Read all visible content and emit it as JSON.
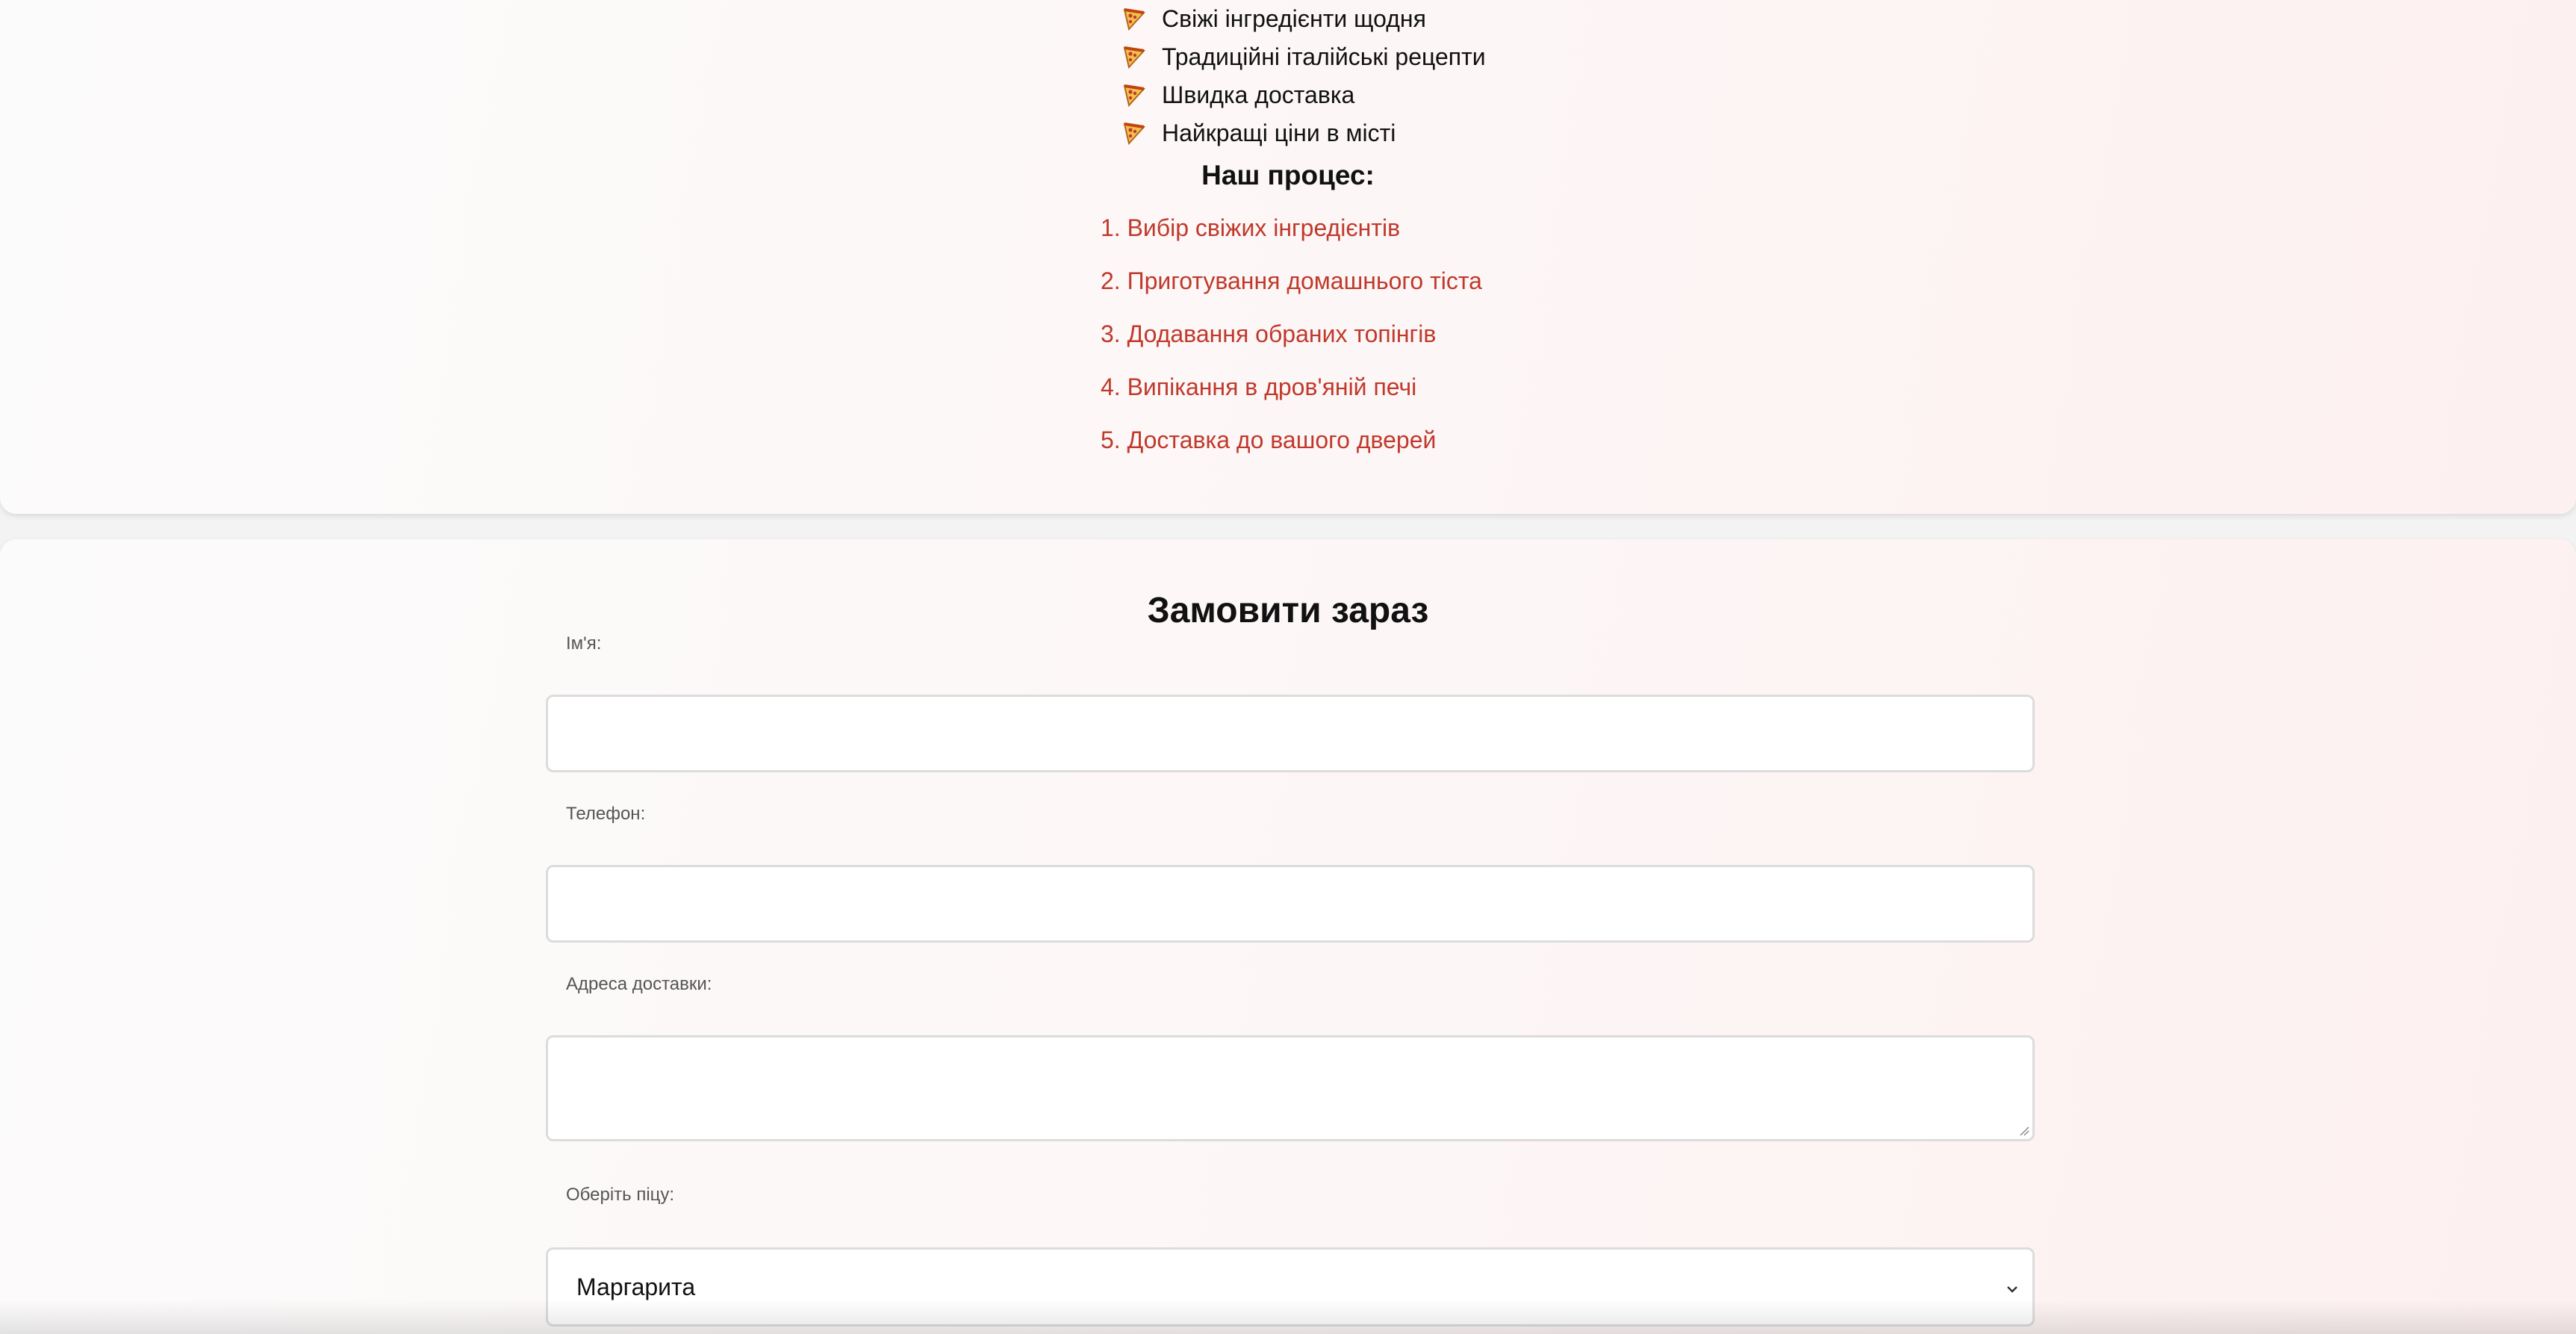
{
  "features": {
    "items": [
      {
        "icon": "pizza-icon",
        "label": "Свіжі інгредієнти щодня"
      },
      {
        "icon": "pizza-icon",
        "label": "Традиційні італійські рецепти"
      },
      {
        "icon": "pizza-icon",
        "label": "Швидка доставка"
      },
      {
        "icon": "pizza-icon",
        "label": "Найкращі ціни в місті"
      }
    ]
  },
  "process": {
    "title": "Наш процес:",
    "steps": [
      "1. Вибір свіжих інгредієнтів",
      "2. Приготування домашнього тіста",
      "3. Додавання обраних топінгів",
      "4. Випікання в дров'яній печі",
      "5. Доставка до вашого дверей"
    ]
  },
  "order_form": {
    "title": "Замовити зараз",
    "name_label": "Ім'я:",
    "name_value": "",
    "phone_label": "Телефон:",
    "phone_value": "",
    "address_label": "Адреса доставки:",
    "address_value": "",
    "pizza_label": "Оберіть піцу:",
    "pizza_selected": "Маргарита"
  },
  "colors": {
    "accent": "#c0392b",
    "text": "#111111",
    "label": "#555555",
    "border": "#dcdcdc"
  }
}
